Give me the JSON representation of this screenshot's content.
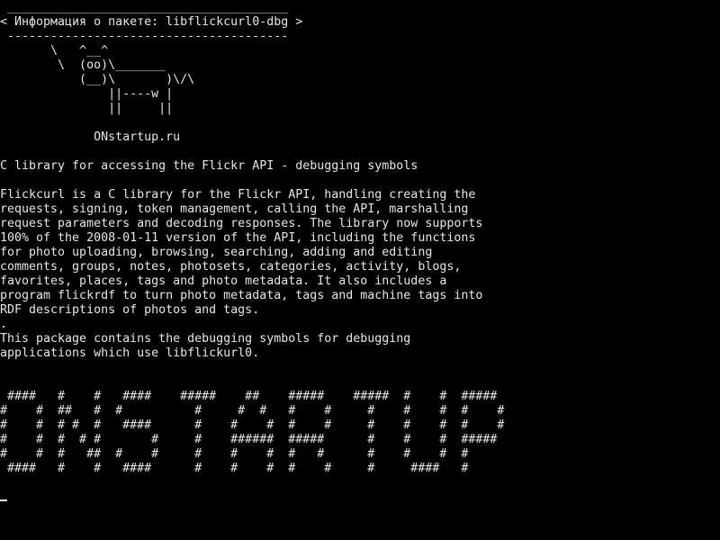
{
  "colors": {
    "background": "#000000",
    "foreground": "#e6e6e6"
  },
  "cowsay": [
    " _______________________________________",
    "< Информация о пакете: libflickcurl0-dbg >",
    " ---------------------------------------",
    "       \\   ^__^",
    "        \\  (oo)\\_______",
    "           (__)\\       )\\/\\",
    "               ||----w |",
    "               ||     ||",
    "",
    "             ONstartup.ru"
  ],
  "summary": "C library for accessing the Flickr API - debugging symbols",
  "description": [
    "Flickcurl is a C library for the Flickr API, handling creating the",
    "requests, signing, token management, calling the API, marshalling",
    "request parameters and decoding responses. The library now supports",
    "100% of the 2008-01-11 version of the API, including the functions",
    "for photo uploading, browsing, searching, adding and editing",
    "comments, groups, notes, photosets, categories, activity, blogs,",
    "favorites, places, tags and photo metadata. It also includes a",
    "program flickrdf to turn photo metadata, tags and machine tags into",
    "RDF descriptions of photos and tags.",
    ".",
    "This package contains the debugging symbols for debugging",
    "applications which use libflickurl0."
  ],
  "banner": [
    " ####   #    #   ####    #####    ##    #####    #####  #    #  #####",
    "#    #  ##   #  #          #     #  #   #    #     #    #    #  #    #",
    "#    #  # #  #   ####      #    #    #  #    #     #    #    #  #    #",
    "#    #  #  # #       #     #    ######  #####      #    #    #  #####",
    "#    #  #   ##  #    #     #    #    #  #   #      #    #    #  #",
    " ####   #    #   ####      #    #    #  #    #     #     ####   #"
  ]
}
